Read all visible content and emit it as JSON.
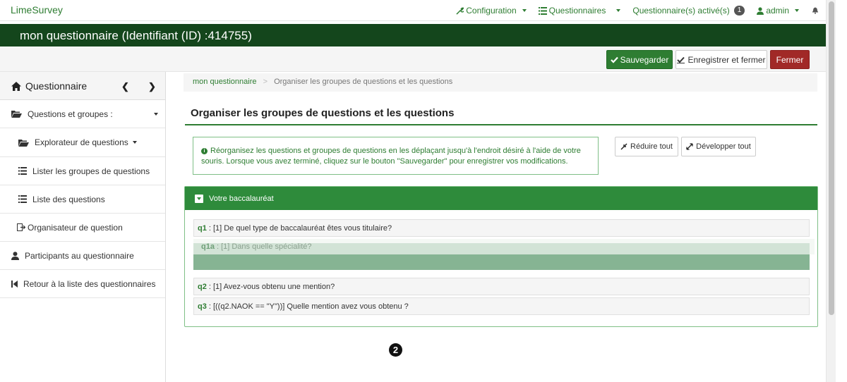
{
  "topnav": {
    "brand": "LimeSurvey",
    "configuration": "Configuration",
    "surveys": "Questionnaires",
    "active_surveys": "Questionnaire(s) activé(s)",
    "active_count": "1",
    "user": "admin"
  },
  "titlebar": {
    "title": "mon questionnaire (Identifiant (ID) :414755)"
  },
  "toolbar": {
    "save": "Sauvegarder",
    "save_close": "Enregistrer et fermer",
    "close": "Fermer"
  },
  "sidebar": {
    "header": "Questionnaire",
    "items": [
      {
        "label": "Questions et groupes :"
      },
      {
        "label": "Explorateur de questions"
      },
      {
        "label": "Lister les groupes de questions"
      },
      {
        "label": "Liste des questions"
      },
      {
        "label": "Organisateur de question"
      },
      {
        "label": "Participants au questionnaire"
      },
      {
        "label": "Retour à la liste des questionnaires"
      }
    ]
  },
  "breadcrumb": {
    "root": "mon questionnaire",
    "separator": ">",
    "current": "Organiser les groupes de questions et les questions"
  },
  "main": {
    "title": "Organiser les groupes de questions et les questions",
    "info_line1": "Réorganisez les questions et groupes de questions en les déplaçant jusqu'à l'endroit désiré à l'aide de votre",
    "info_line2": "souris. Lorsque vous avez terminé, cliquez sur le bouton \"Sauvegarder\" pour enregistrer vos modifications.",
    "collapse_all": "Réduire tout",
    "expand_all": "Développer tout",
    "group": {
      "title": "Votre baccalauréat",
      "questions": [
        {
          "code": "q1",
          "text": ": [1] De quel type de baccalauréat êtes vous titulaire?"
        },
        {
          "code": "q1a",
          "text": ": [1] Dans quelle spécialité?"
        },
        {
          "code": "q2",
          "text": ": [1] Avez-vous obtenu une mention?"
        },
        {
          "code": "q3",
          "text": ": [((q2.NAOK == \"Y\"))] Quelle mention avez vous obtenu ?"
        }
      ]
    }
  },
  "marker": {
    "label": "2"
  },
  "colors": {
    "primary": "#2e7d32",
    "dark_header": "#14461c",
    "danger": "#a12927",
    "group_header": "#2e8b3b"
  }
}
